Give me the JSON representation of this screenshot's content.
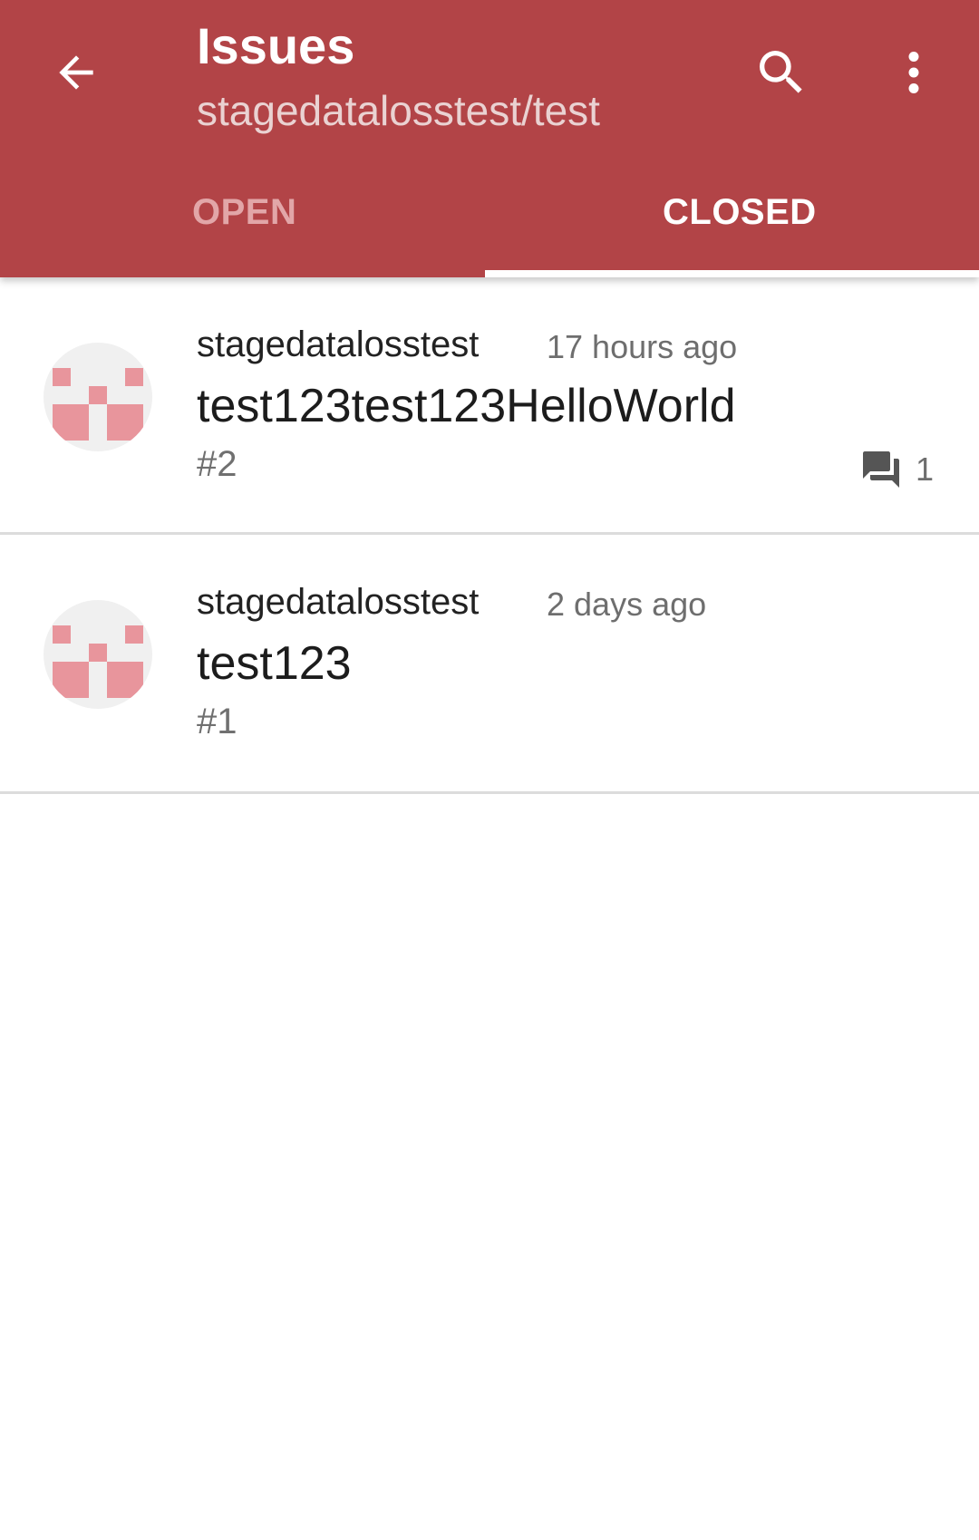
{
  "colors": {
    "app_bar": "#b24447",
    "tab_inactive": "#e2a6a8",
    "avatar_pixel": "#e8959c"
  },
  "header": {
    "title": "Issues",
    "subtitle": "stagedatalosstest/test",
    "back_icon": "arrow-back-icon",
    "search_icon": "search-icon",
    "more_icon": "more-vert-icon"
  },
  "tabs": [
    {
      "label": "OPEN",
      "selected": false
    },
    {
      "label": "CLOSED",
      "selected": true
    }
  ],
  "issues": [
    {
      "author": "stagedatalosstest",
      "time": "17 hours ago",
      "title": "test123test123HelloWorld",
      "number": "#2",
      "comments": "1"
    },
    {
      "author": "stagedatalosstest",
      "time": "2 days ago",
      "title": "test123",
      "number": "#1"
    }
  ]
}
